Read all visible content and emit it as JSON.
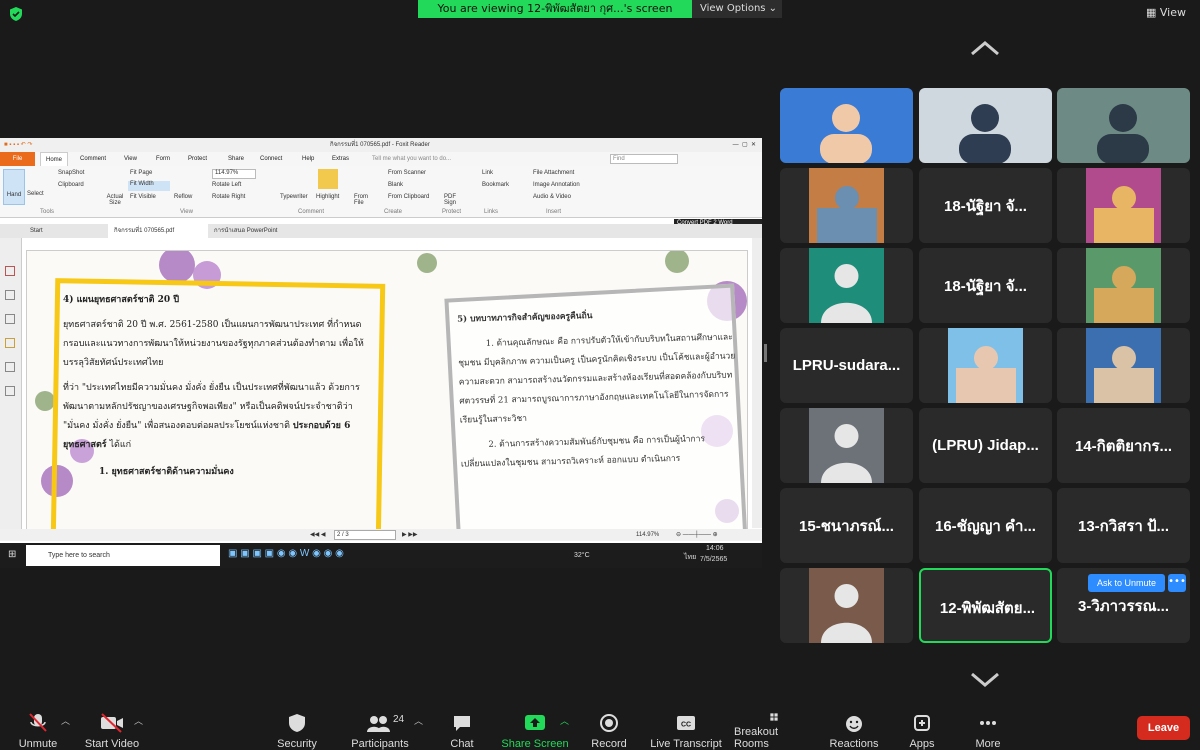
{
  "banner": {
    "text": "You are viewing 12-พิพัฒสัตยา กุศ...'s screen",
    "view_options": "View Options ⌄"
  },
  "view_button": "View",
  "shared": {
    "window_title": "กิจกรรมที่1 070565.pdf - Foxit Reader",
    "ribbon_tabs": [
      "File",
      "Home",
      "Comment",
      "View",
      "Form",
      "Protect",
      "Share",
      "Connect",
      "Help",
      "Extras"
    ],
    "tell_me": "Tell me what you want to do...",
    "find_placeholder": "Find",
    "tools": {
      "hand": "Hand",
      "select": "Select",
      "snapshot": "SnapShot",
      "clipboard": "Clipboard",
      "actual_size": "Actual Size",
      "fit_page": "Fit Page",
      "fit_width": "Fit Width",
      "fit_visible": "Fit Visible",
      "reflow": "Reflow",
      "zoom": "114.97%",
      "rotate_left": "Rotate Left",
      "rotate_right": "Rotate Right",
      "typewriter": "Typewriter",
      "highlight": "Highlight",
      "from_file": "From File",
      "from_scanner": "From Scanner",
      "blank": "Blank",
      "from_clipboard": "From Clipboard",
      "pdf_sign": "PDF Sign",
      "link": "Link",
      "bookmark": "Bookmark",
      "file_attachment": "File Attachment",
      "image_annotation": "Image Annotation",
      "audio_video": "Audio & Video"
    },
    "groups": [
      "Tools",
      "View",
      "Comment",
      "Create",
      "Protect",
      "Links",
      "Insert"
    ],
    "convert": "Convert PDF 2 Word",
    "doc_tabs": [
      "Start",
      "กิจกรรมที่1 070565.pdf",
      "การนำเสนอ PowerPoint"
    ],
    "page": {
      "left_heading": "4) แผนยุทธศาสตร์ชาติ 20 ปี",
      "left_p1": "ยุทธศาสตร์ชาติ 20 ปี พ.ศ. 2561-2580 เป็นแผนการพัฒนาประเทศ ที่กำหนดกรอบและแนวทางการพัฒนาให้หน่วยงานของรัฐทุกภาคส่วนต้องทำตาม เพื่อให้บรรลุวิสัยทัศน์ประเทศไทย",
      "left_p2": "ที่ว่า \"ประเทศไทยมีความมั่นคง มั่งคั่ง ยั่งยืน เป็นประเทศที่พัฒนาแล้ว ด้วยการพัฒนาตามหลักปรัชญาของเศรษฐกิจพอเพียง\" หรือเป็นคติพจน์ประจำชาติว่า \"มั่นคง มั่งคั่ง ยั่งยืน\" เพื่อสนองตอบต่อผลประโยชน์แห่งชาติ",
      "left_bold": "ประกอบด้วย 6 ยุทธศาสตร์",
      "left_tail": " ได้แก่",
      "left_item": "1. ยุทธศาสตร์ชาติด้านความมั่นคง",
      "right_heading": "5) บทบาทภารกิจสำคัญของครูคืนถิ่น",
      "right_p1": "1. ด้านคุณลักษณะ คือ การปรับตัวให้เข้ากับบริบทในสถานศึกษาและชุมชน มีบุคลิกภาพ ความเป็นครู เป็นครูนักคิดเชิงระบบ เป็นโค้ชและผู้อำนวยความสะดวก สามารถสร้างนวัตกรรมและสร้างห้องเรียนที่สอดคล้องกับบริบทศตวรรษที่ 21 สามารถบูรณาการภาษาอังกฤษและเทคโนโลยีในการจัดการเรียนรู้ในสาระวิชา",
      "right_p2": "2. ด้านการสร้างความสัมพันธ์กับชุมชน คือ การเป็นผู้นำการ เปลี่ยนแปลงในชุมชน สามารถวิเคราะห์ ออกแบบ ดำเนินการ"
    },
    "page_nav": "2 / 3",
    "status_zoom": "114.97%",
    "taskbar": {
      "search": "Type here to search",
      "temp": "32°C",
      "lang": "ไทย",
      "time": "14:06",
      "date": "7/5/2565"
    }
  },
  "tiles": [
    {
      "name": "",
      "kind": "video"
    },
    {
      "name": "",
      "kind": "video"
    },
    {
      "name": "",
      "kind": "video"
    },
    {
      "name": "",
      "kind": "photo"
    },
    {
      "name": "18-นัฐิยา จั...",
      "kind": "name"
    },
    {
      "name": "",
      "kind": "photo"
    },
    {
      "name": "",
      "kind": "avatar"
    },
    {
      "name": "18-นัฐิยา จั...",
      "kind": "name"
    },
    {
      "name": "",
      "kind": "photo"
    },
    {
      "name": "LPRU-sudara...",
      "kind": "name"
    },
    {
      "name": "",
      "kind": "photo"
    },
    {
      "name": "",
      "kind": "photo"
    },
    {
      "name": "",
      "kind": "avatar"
    },
    {
      "name": "(LPRU) Jidap...",
      "kind": "name"
    },
    {
      "name": "14-กิตติยากร...",
      "kind": "name"
    },
    {
      "name": "15-ชนาภรณ์...",
      "kind": "name"
    },
    {
      "name": "16-ชัญญา คำ...",
      "kind": "name"
    },
    {
      "name": "13-กวิสรา ป้...",
      "kind": "name"
    },
    {
      "name": "",
      "kind": "avatar"
    },
    {
      "name": "12-พิพัฒสัตย...",
      "kind": "name"
    },
    {
      "name": "3-วิภาวรรณ...",
      "kind": "name"
    }
  ],
  "ask_to_unmute": "Ask to Unmute",
  "more_dots": "•••",
  "toolbar": {
    "unmute": "Unmute",
    "start_video": "Start Video",
    "security": "Security",
    "participants": "Participants",
    "participants_count": "24",
    "chat": "Chat",
    "share_screen": "Share Screen",
    "record": "Record",
    "live_transcript": "Live Transcript",
    "breakout_rooms": "Breakout Rooms",
    "reactions": "Reactions",
    "apps": "Apps",
    "more": "More",
    "leave": "Leave"
  },
  "colors": {
    "accent_green": "#23d959",
    "leave_red": "#d52b1e",
    "blue": "#2d8cff",
    "avatar_bg_teal": "#1e8d7a",
    "avatar_bg_gray": "#6c7278",
    "avatar_bg_brown": "#7a5a4a"
  }
}
